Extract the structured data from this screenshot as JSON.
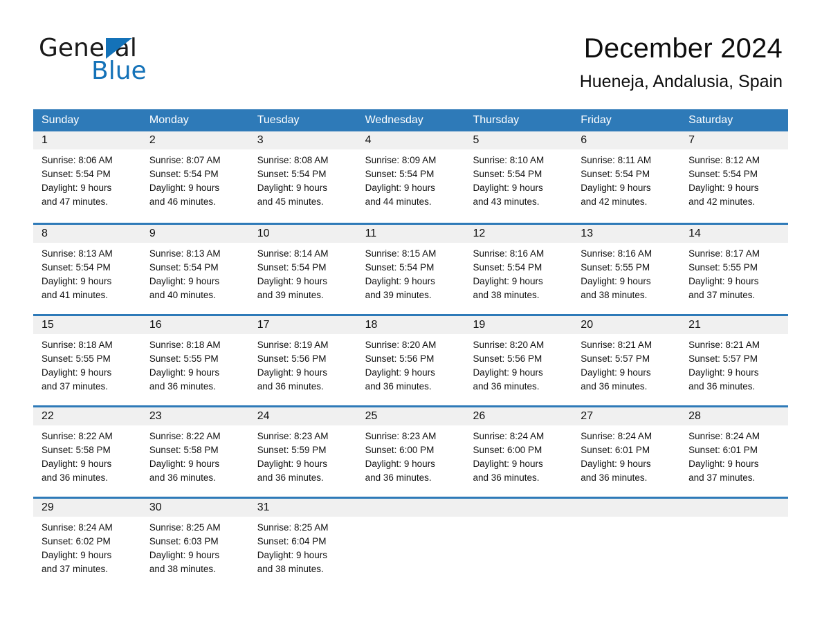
{
  "brand": {
    "name_part1": "General",
    "name_part2": "Blue",
    "triangle_color": "#1472b8",
    "logo_icon": "general-blue-logo"
  },
  "header": {
    "title": "December 2024",
    "subtitle": "Hueneja, Andalusia, Spain"
  },
  "theme": {
    "header_blue": "#2e7ab8",
    "day_band_gray": "#f0f0f0",
    "text_black": "#111111"
  },
  "weekdays": [
    "Sunday",
    "Monday",
    "Tuesday",
    "Wednesday",
    "Thursday",
    "Friday",
    "Saturday"
  ],
  "weeks": [
    [
      {
        "date": "1",
        "sunrise": "Sunrise: 8:06 AM",
        "sunset": "Sunset: 5:54 PM",
        "daylight1": "Daylight: 9 hours",
        "daylight2": "and 47 minutes."
      },
      {
        "date": "2",
        "sunrise": "Sunrise: 8:07 AM",
        "sunset": "Sunset: 5:54 PM",
        "daylight1": "Daylight: 9 hours",
        "daylight2": "and 46 minutes."
      },
      {
        "date": "3",
        "sunrise": "Sunrise: 8:08 AM",
        "sunset": "Sunset: 5:54 PM",
        "daylight1": "Daylight: 9 hours",
        "daylight2": "and 45 minutes."
      },
      {
        "date": "4",
        "sunrise": "Sunrise: 8:09 AM",
        "sunset": "Sunset: 5:54 PM",
        "daylight1": "Daylight: 9 hours",
        "daylight2": "and 44 minutes."
      },
      {
        "date": "5",
        "sunrise": "Sunrise: 8:10 AM",
        "sunset": "Sunset: 5:54 PM",
        "daylight1": "Daylight: 9 hours",
        "daylight2": "and 43 minutes."
      },
      {
        "date": "6",
        "sunrise": "Sunrise: 8:11 AM",
        "sunset": "Sunset: 5:54 PM",
        "daylight1": "Daylight: 9 hours",
        "daylight2": "and 42 minutes."
      },
      {
        "date": "7",
        "sunrise": "Sunrise: 8:12 AM",
        "sunset": "Sunset: 5:54 PM",
        "daylight1": "Daylight: 9 hours",
        "daylight2": "and 42 minutes."
      }
    ],
    [
      {
        "date": "8",
        "sunrise": "Sunrise: 8:13 AM",
        "sunset": "Sunset: 5:54 PM",
        "daylight1": "Daylight: 9 hours",
        "daylight2": "and 41 minutes."
      },
      {
        "date": "9",
        "sunrise": "Sunrise: 8:13 AM",
        "sunset": "Sunset: 5:54 PM",
        "daylight1": "Daylight: 9 hours",
        "daylight2": "and 40 minutes."
      },
      {
        "date": "10",
        "sunrise": "Sunrise: 8:14 AM",
        "sunset": "Sunset: 5:54 PM",
        "daylight1": "Daylight: 9 hours",
        "daylight2": "and 39 minutes."
      },
      {
        "date": "11",
        "sunrise": "Sunrise: 8:15 AM",
        "sunset": "Sunset: 5:54 PM",
        "daylight1": "Daylight: 9 hours",
        "daylight2": "and 39 minutes."
      },
      {
        "date": "12",
        "sunrise": "Sunrise: 8:16 AM",
        "sunset": "Sunset: 5:54 PM",
        "daylight1": "Daylight: 9 hours",
        "daylight2": "and 38 minutes."
      },
      {
        "date": "13",
        "sunrise": "Sunrise: 8:16 AM",
        "sunset": "Sunset: 5:55 PM",
        "daylight1": "Daylight: 9 hours",
        "daylight2": "and 38 minutes."
      },
      {
        "date": "14",
        "sunrise": "Sunrise: 8:17 AM",
        "sunset": "Sunset: 5:55 PM",
        "daylight1": "Daylight: 9 hours",
        "daylight2": "and 37 minutes."
      }
    ],
    [
      {
        "date": "15",
        "sunrise": "Sunrise: 8:18 AM",
        "sunset": "Sunset: 5:55 PM",
        "daylight1": "Daylight: 9 hours",
        "daylight2": "and 37 minutes."
      },
      {
        "date": "16",
        "sunrise": "Sunrise: 8:18 AM",
        "sunset": "Sunset: 5:55 PM",
        "daylight1": "Daylight: 9 hours",
        "daylight2": "and 36 minutes."
      },
      {
        "date": "17",
        "sunrise": "Sunrise: 8:19 AM",
        "sunset": "Sunset: 5:56 PM",
        "daylight1": "Daylight: 9 hours",
        "daylight2": "and 36 minutes."
      },
      {
        "date": "18",
        "sunrise": "Sunrise: 8:20 AM",
        "sunset": "Sunset: 5:56 PM",
        "daylight1": "Daylight: 9 hours",
        "daylight2": "and 36 minutes."
      },
      {
        "date": "19",
        "sunrise": "Sunrise: 8:20 AM",
        "sunset": "Sunset: 5:56 PM",
        "daylight1": "Daylight: 9 hours",
        "daylight2": "and 36 minutes."
      },
      {
        "date": "20",
        "sunrise": "Sunrise: 8:21 AM",
        "sunset": "Sunset: 5:57 PM",
        "daylight1": "Daylight: 9 hours",
        "daylight2": "and 36 minutes."
      },
      {
        "date": "21",
        "sunrise": "Sunrise: 8:21 AM",
        "sunset": "Sunset: 5:57 PM",
        "daylight1": "Daylight: 9 hours",
        "daylight2": "and 36 minutes."
      }
    ],
    [
      {
        "date": "22",
        "sunrise": "Sunrise: 8:22 AM",
        "sunset": "Sunset: 5:58 PM",
        "daylight1": "Daylight: 9 hours",
        "daylight2": "and 36 minutes."
      },
      {
        "date": "23",
        "sunrise": "Sunrise: 8:22 AM",
        "sunset": "Sunset: 5:58 PM",
        "daylight1": "Daylight: 9 hours",
        "daylight2": "and 36 minutes."
      },
      {
        "date": "24",
        "sunrise": "Sunrise: 8:23 AM",
        "sunset": "Sunset: 5:59 PM",
        "daylight1": "Daylight: 9 hours",
        "daylight2": "and 36 minutes."
      },
      {
        "date": "25",
        "sunrise": "Sunrise: 8:23 AM",
        "sunset": "Sunset: 6:00 PM",
        "daylight1": "Daylight: 9 hours",
        "daylight2": "and 36 minutes."
      },
      {
        "date": "26",
        "sunrise": "Sunrise: 8:24 AM",
        "sunset": "Sunset: 6:00 PM",
        "daylight1": "Daylight: 9 hours",
        "daylight2": "and 36 minutes."
      },
      {
        "date": "27",
        "sunrise": "Sunrise: 8:24 AM",
        "sunset": "Sunset: 6:01 PM",
        "daylight1": "Daylight: 9 hours",
        "daylight2": "and 36 minutes."
      },
      {
        "date": "28",
        "sunrise": "Sunrise: 8:24 AM",
        "sunset": "Sunset: 6:01 PM",
        "daylight1": "Daylight: 9 hours",
        "daylight2": "and 37 minutes."
      }
    ],
    [
      {
        "date": "29",
        "sunrise": "Sunrise: 8:24 AM",
        "sunset": "Sunset: 6:02 PM",
        "daylight1": "Daylight: 9 hours",
        "daylight2": "and 37 minutes."
      },
      {
        "date": "30",
        "sunrise": "Sunrise: 8:25 AM",
        "sunset": "Sunset: 6:03 PM",
        "daylight1": "Daylight: 9 hours",
        "daylight2": "and 38 minutes."
      },
      {
        "date": "31",
        "sunrise": "Sunrise: 8:25 AM",
        "sunset": "Sunset: 6:04 PM",
        "daylight1": "Daylight: 9 hours",
        "daylight2": "and 38 minutes."
      },
      {
        "date": "",
        "sunrise": "",
        "sunset": "",
        "daylight1": "",
        "daylight2": ""
      },
      {
        "date": "",
        "sunrise": "",
        "sunset": "",
        "daylight1": "",
        "daylight2": ""
      },
      {
        "date": "",
        "sunrise": "",
        "sunset": "",
        "daylight1": "",
        "daylight2": ""
      },
      {
        "date": "",
        "sunrise": "",
        "sunset": "",
        "daylight1": "",
        "daylight2": ""
      }
    ]
  ]
}
